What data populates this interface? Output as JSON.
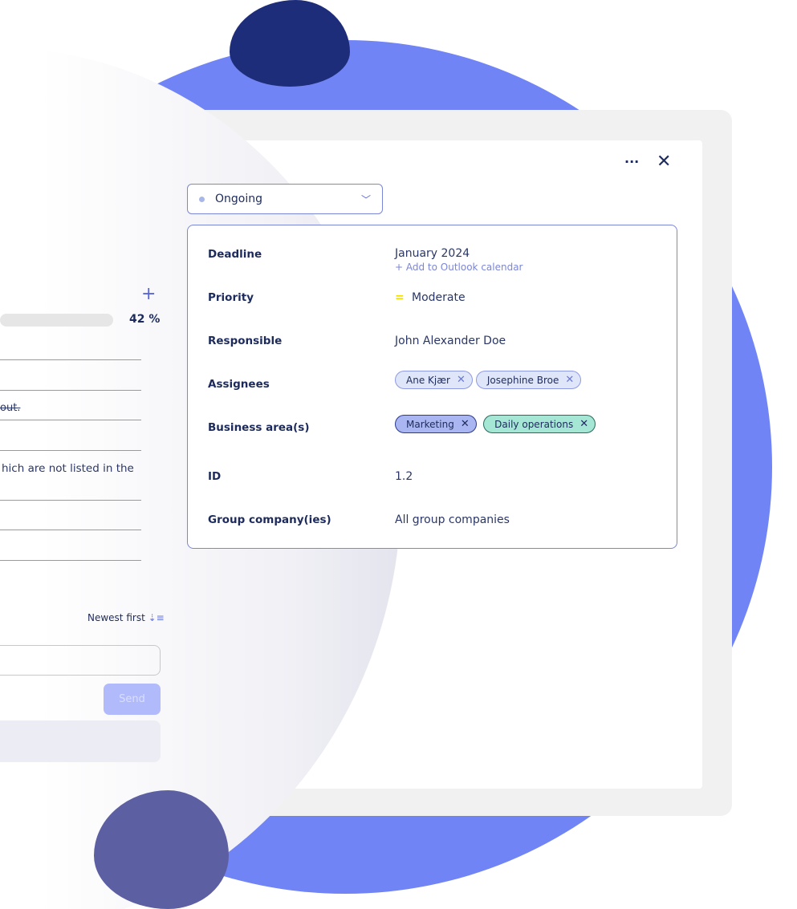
{
  "header": {
    "menu_icon": "ellipsis-icon",
    "close_icon": "close-icon"
  },
  "status": {
    "value": "Ongoing",
    "dot_color": "#a9b7e8"
  },
  "details": [
    {
      "label": "Deadline",
      "value": "January 2024",
      "link": "+ Add to Outlook calendar"
    },
    {
      "label": "Priority",
      "value": "Moderate",
      "icon": "equals-icon",
      "icon_color": "#f2e000"
    },
    {
      "label": "Responsible",
      "value": "John Alexander Doe"
    },
    {
      "label": "Assignees",
      "chips": [
        "Ane Kjær",
        "Josephine Broe"
      ]
    },
    {
      "label": "Business area(s)",
      "chips": [
        "Marketing",
        "Daily operations"
      ]
    },
    {
      "label": "ID",
      "value": "1.2"
    },
    {
      "label": "Group company(ies)",
      "value": "All group companies"
    }
  ],
  "left": {
    "progress_percent": 42,
    "progress_label": "42 %",
    "item_struck": "out.",
    "item_text": "hich are not listed in the",
    "sort_label": "Newest first",
    "send_label": "Send"
  },
  "colors": {
    "accent": "#7184f6",
    "dark_blob": "#1e2d7a",
    "chip_marketing": "#aab6f2",
    "chip_daily": "#a5e6d5"
  }
}
